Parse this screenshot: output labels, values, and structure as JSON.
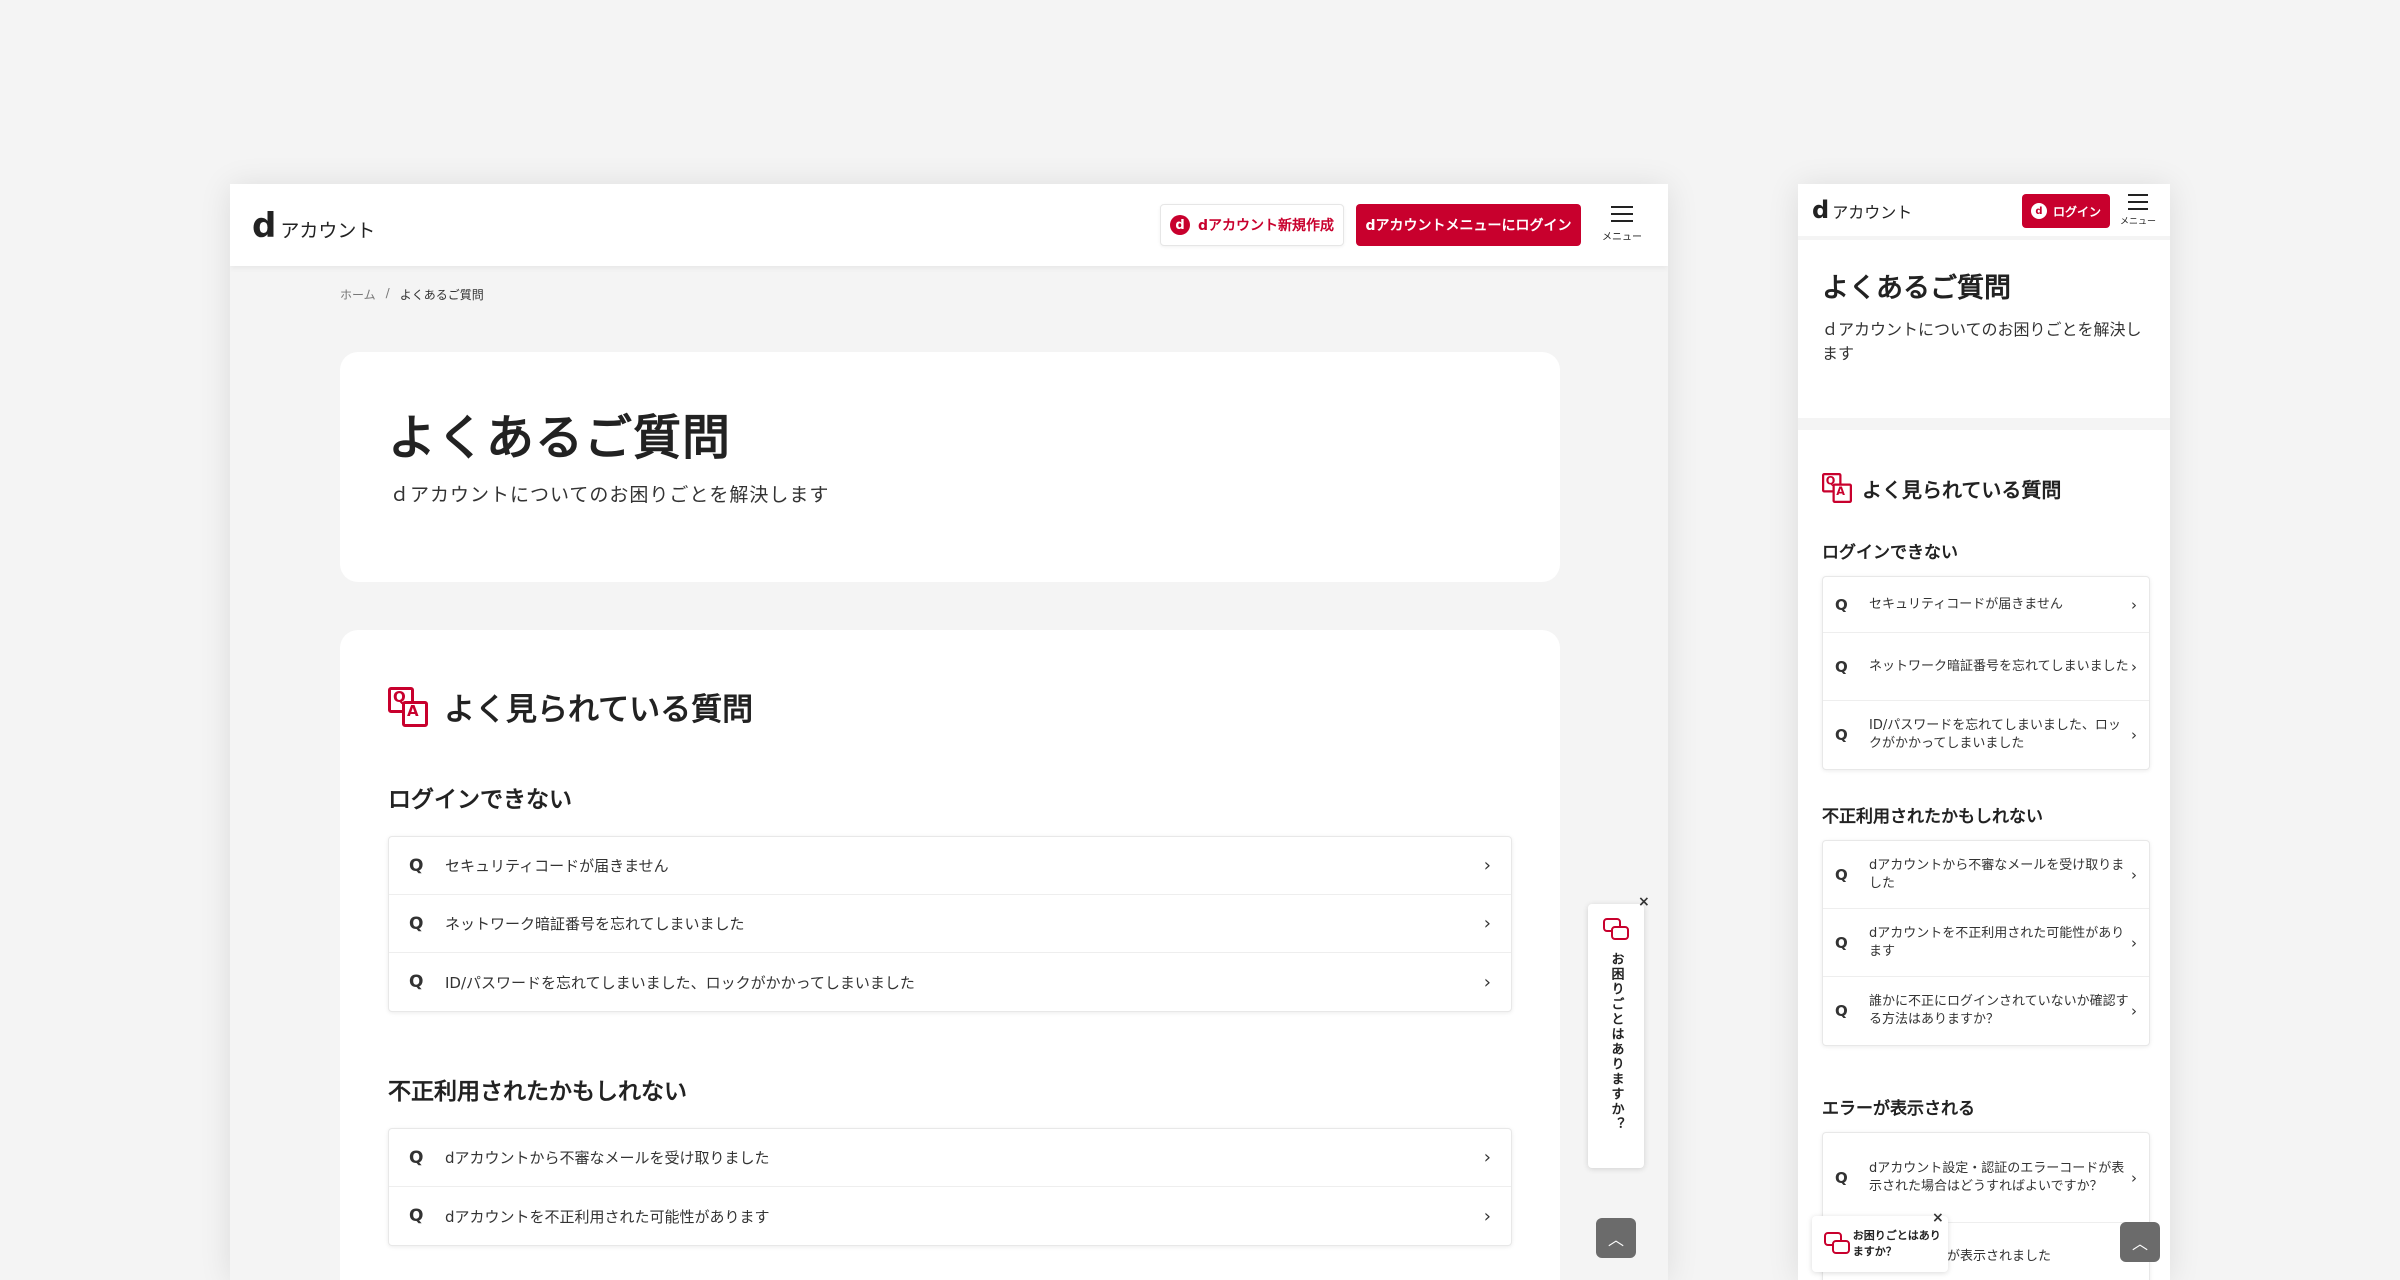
{
  "brand": {
    "logo_d": "d",
    "logo_text": "アカウント",
    "accent": "#c8002d"
  },
  "desktop": {
    "header": {
      "new_account": "dアカウント新規作成",
      "login": "dアカウントメニューにログイン",
      "menu": "メニュー",
      "d_mark": "d"
    },
    "breadcrumb": {
      "home": "ホーム",
      "sep": "/",
      "current": "よくあるご質問"
    },
    "title": "よくあるご質問",
    "subtitle": "ｄアカウントについてのお困りごとを解決します",
    "faq_heading": "よく見られている質問",
    "categories": [
      {
        "title": "ログインできない",
        "items": [
          "セキュリティコードが届きません",
          "ネットワーク暗証番号を忘れてしまいました",
          "ID/パスワードを忘れてしまいました、ロックがかかってしまいました"
        ]
      },
      {
        "title": "不正利用されたかもしれない",
        "items": [
          "dアカウントから不審なメールを受け取りました",
          "dアカウントを不正利用された可能性があります"
        ]
      }
    ],
    "q_mark": "Q",
    "chevron": "›",
    "help_tab": "お困りごとはありますか？",
    "close": "×",
    "to_top": "︿"
  },
  "mobile": {
    "header": {
      "login": "ログイン",
      "menu": "メニュー",
      "d_mark": "d"
    },
    "title": "よくあるご質問",
    "subtitle": "ｄアカウントについてのお困りごとを解決します",
    "faq_heading": "よく見られている質問",
    "categories": [
      {
        "title": "ログインできない",
        "items": [
          "セキュリティコードが届きません",
          "ネットワーク暗証番号を忘れてしまいました",
          "ID/パスワードを忘れてしまいました、ロックがかかってしまいました"
        ]
      },
      {
        "title": "不正利用されたかもしれない",
        "items": [
          "dアカウントから不審なメールを受け取りました",
          "dアカウントを不正利用された可能性があります",
          "誰かに不正にログインされていないか確認する方法はありますか？"
        ]
      },
      {
        "title": "エラーが表示される",
        "items": [
          "dアカウント設定・認証のエラーコードが表示された場合はどうすればよいですか？",
          "エラーコードが表示されました"
        ]
      }
    ],
    "help_chat": "お困りごとはありますか？",
    "close": "×",
    "to_top": "︿"
  }
}
